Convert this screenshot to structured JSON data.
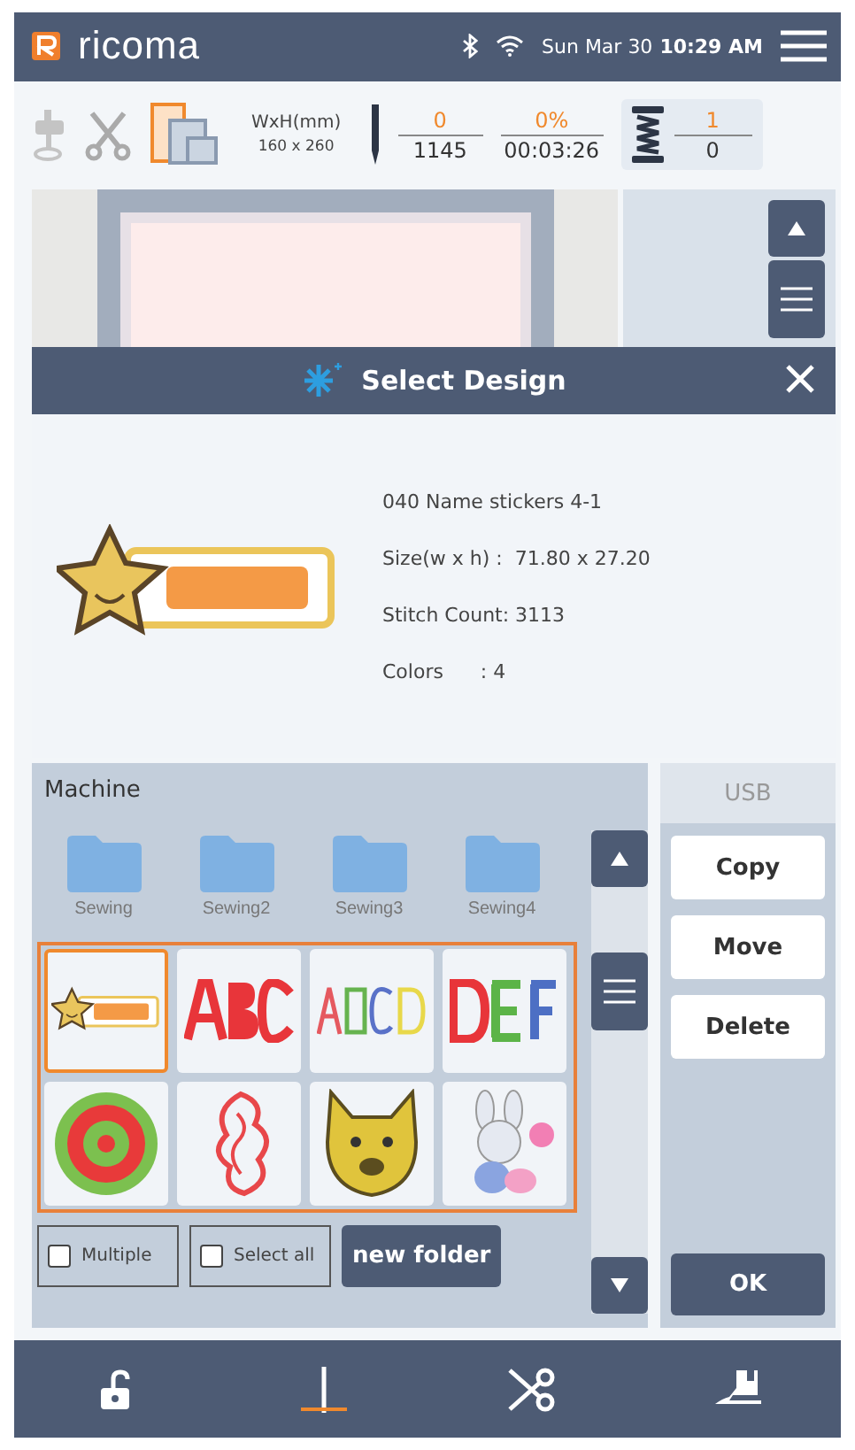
{
  "header": {
    "logo": "ricoma",
    "date": "Sun Mar 30",
    "time": "10:29 AM"
  },
  "toolbar": {
    "size_label": "WxH(mm)",
    "size_value": "160 x 260",
    "stitch_current": "0",
    "stitch_total": "1145",
    "progress": "0%",
    "time": "00:03:26",
    "color_current": "1",
    "color_total": "0"
  },
  "dialog": {
    "title": "Select Design",
    "design_name": "040 Name stickers 4-1",
    "size": "Size(w x h) :  71.80 x 27.20",
    "stitch_count": "Stitch Count: 3113",
    "colors": "Colors      : 4"
  },
  "sources": [
    {
      "label": "Machine",
      "selected": true
    },
    {
      "label": "USB",
      "selected": false
    }
  ],
  "folders": [
    "Sewing",
    "Sewing2",
    "Sewing3",
    "Sewing4"
  ],
  "designs": [
    {
      "kind": "sticker",
      "selected": true
    },
    {
      "kind": "red-letters",
      "selected": false
    },
    {
      "kind": "color-letters",
      "selected": false
    },
    {
      "kind": "stitch-letters",
      "selected": false
    },
    {
      "kind": "mandala",
      "selected": false
    },
    {
      "kind": "dragon",
      "selected": false
    },
    {
      "kind": "dog",
      "selected": false
    },
    {
      "kind": "bunny",
      "selected": false
    }
  ],
  "options": [
    {
      "label": "Multiple",
      "checked": false
    },
    {
      "label": "Select all",
      "checked": false
    }
  ],
  "new_folder": "new folder",
  "actions": [
    "Copy",
    "Move",
    "Delete"
  ],
  "ok": "OK",
  "nav": [
    {
      "kind": "lock",
      "selected": false
    },
    {
      "kind": "needle",
      "selected": true
    },
    {
      "kind": "scissors",
      "selected": false
    },
    {
      "kind": "foot",
      "selected": false
    }
  ]
}
